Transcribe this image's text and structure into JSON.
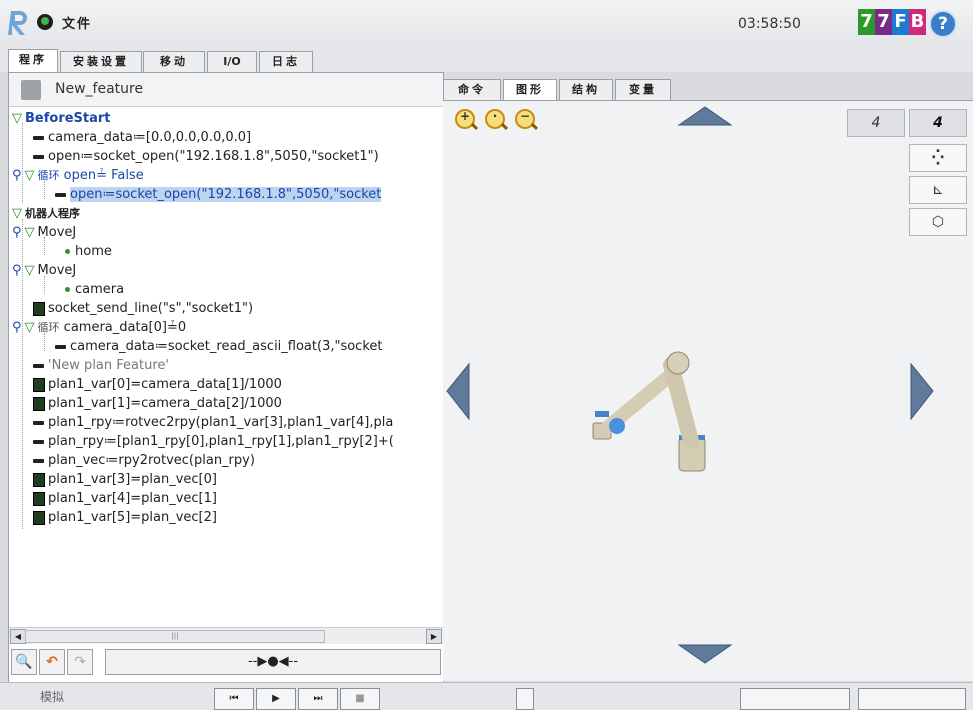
{
  "topbar": {
    "file_menu": "文件",
    "clock": "03:58:50",
    "robot_id": [
      "7",
      "7",
      "F",
      "B"
    ],
    "robot_id_colors": [
      "#2b9a2b",
      "#7a2a8a",
      "#1d7bd1",
      "#d0287a"
    ],
    "help_label": "?"
  },
  "main_tabs": [
    {
      "label": "程序",
      "active": true
    },
    {
      "label": "安装设置",
      "active": false
    },
    {
      "label": "移动",
      "active": false
    },
    {
      "label": "I/O",
      "active": false
    },
    {
      "label": "日志",
      "active": false
    }
  ],
  "node_header": {
    "name": "New_feature"
  },
  "tree": [
    {
      "toggle": "▽",
      "text": "BeforeStart"
    },
    {
      "text": "camera_data≔[0.0,0.0,0.0,0.0]"
    },
    {
      "text": "open≔socket_open(\"192.168.1.8\",5050,\"socket1\")"
    },
    {
      "toggle": "▽",
      "kw": "循环",
      "text": "open≟ False"
    },
    {
      "text": "open≔socket_open(\"192.168.1.8\",5050,\"socket"
    },
    {
      "toggle": "▽",
      "text": "机器人程序"
    },
    {
      "toggle": "▽",
      "text": "MoveJ"
    },
    {
      "text": "home"
    },
    {
      "toggle": "▽",
      "text": "MoveJ"
    },
    {
      "text": "camera"
    },
    {
      "text": "socket_send_line(\"s\",\"socket1\")"
    },
    {
      "toggle": "▽",
      "kw": "循环",
      "text": "camera_data[0]≟0"
    },
    {
      "text": "camera_data≔socket_read_ascii_float(3,\"socket"
    },
    {
      "text": "'New plan Feature'"
    },
    {
      "text": "plan1_var[0]=camera_data[1]/1000"
    },
    {
      "text": "plan1_var[1]=camera_data[2]/1000"
    },
    {
      "text": "plan1_rpy≔rotvec2rpy(plan1_var[3],plan1_var[4],pla"
    },
    {
      "text": "plan_rpy≔[plan1_rpy[0],plan1_rpy[1],plan1_rpy[2]+("
    },
    {
      "text": "plan_vec≔rpy2rotvec(plan_rpy)"
    },
    {
      "text": "plan1_var[3]=plan_vec[0]"
    },
    {
      "text": "plan1_var[4]=plan_vec[1]"
    },
    {
      "text": "plan1_var[5]=plan_vec[2]"
    }
  ],
  "scroll": {
    "left": "◀",
    "thumb": "|||",
    "right": "▶"
  },
  "tools": {
    "search": "🔍",
    "undo": "↶",
    "redo": "↷",
    "play_symbol": "--▶●◀--"
  },
  "sub_tabs": [
    {
      "label": "命令",
      "active": false
    },
    {
      "label": "图形",
      "active": true
    },
    {
      "label": "结构",
      "active": false
    },
    {
      "label": "变量",
      "active": false
    }
  ],
  "graphics": {
    "zoom": [
      "+",
      "·",
      "−"
    ],
    "view_buttons": [
      "4",
      "4"
    ],
    "side_buttons": [
      "⁛",
      "⊾",
      "⬡"
    ]
  },
  "bottombar": {
    "speed_label": "模拟",
    "play_controls": [
      "⏮",
      "▶",
      "⏭",
      "■"
    ]
  }
}
